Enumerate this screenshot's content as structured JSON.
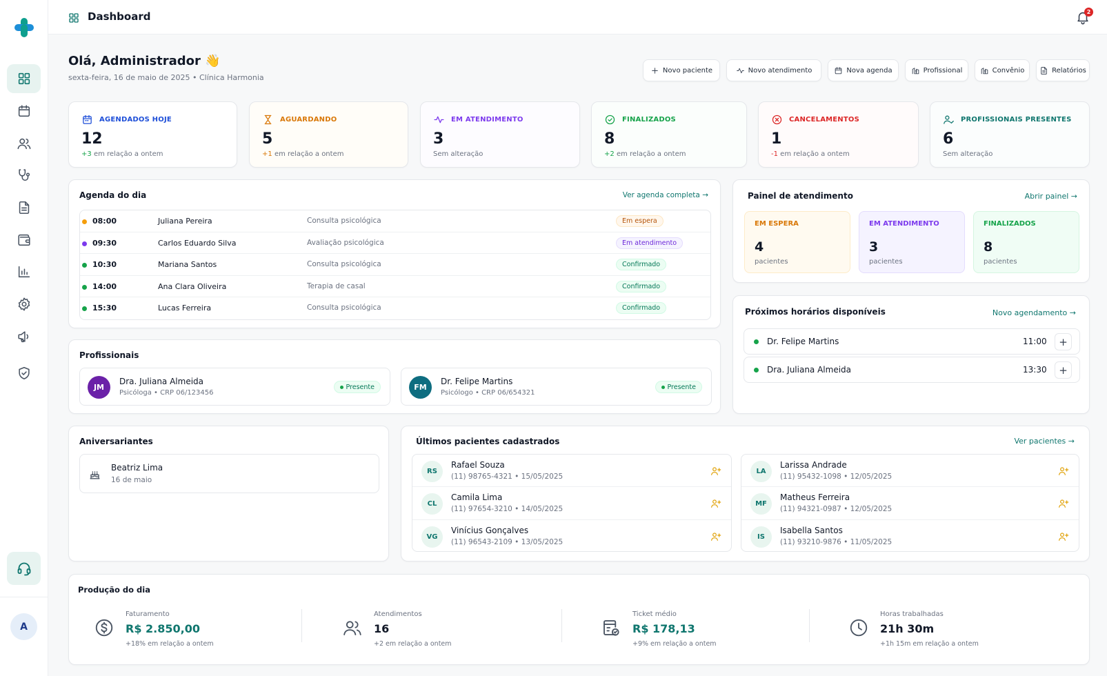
{
  "topbar": {
    "title": "Dashboard",
    "notifications": "2"
  },
  "sidebar": {
    "items": [
      "grid-icon",
      "calendar-icon",
      "users-icon",
      "stethoscope-icon",
      "document-icon",
      "wallet-icon",
      "bar-chart-icon",
      "gear-icon",
      "megaphone-icon",
      "shield-icon"
    ],
    "support": "headset-icon",
    "user_initial": "A"
  },
  "greeting": {
    "title": "Olá, Administrador 👋",
    "subtitle": "sexta-feira, 16 de maio de 2025 • Clínica Harmonia"
  },
  "actions": [
    {
      "label": "Novo paciente",
      "icon": "plus-icon"
    },
    {
      "label": "Novo atendimento",
      "icon": "activity-icon"
    },
    {
      "label": "Nova agenda",
      "icon": "calendar-icon"
    },
    {
      "label": "Profissional",
      "icon": "building-icon"
    },
    {
      "label": "Convênio",
      "icon": "building-icon"
    },
    {
      "label": "Relatórios",
      "icon": "document-icon"
    }
  ],
  "stats": [
    {
      "label": "AGENDADOS HOJE",
      "value": "12",
      "delta": "+3",
      "change": "em relação a ontem",
      "color": "#1d4ed8",
      "bg": "#ffffff"
    },
    {
      "label": "AGUARDANDO",
      "value": "5",
      "delta": "+1",
      "change": "em relação a ontem",
      "color": "#d97706",
      "bg": "#fffdf8"
    },
    {
      "label": "EM ATENDIMENTO",
      "value": "3",
      "delta": "",
      "change": "Sem alteração",
      "color": "#7c3aed",
      "bg": "#fdfcff"
    },
    {
      "label": "FINALIZADOS",
      "value": "8",
      "delta": "+2",
      "change": "em relação a ontem",
      "color": "#16a34a",
      "bg": "#fbfefc"
    },
    {
      "label": "CANCELAMENTOS",
      "value": "1",
      "delta": "-1",
      "change": "em relação a ontem",
      "color": "#dc2626",
      "bg": "#fffbfb"
    },
    {
      "label": "PROFISSIONAIS PRESENTES",
      "value": "6",
      "delta": "",
      "change": "Sem alteração",
      "color": "#0f766e",
      "bg": "#fbfdfd"
    }
  ],
  "agenda": {
    "title": "Agenda do dia",
    "link": "Ver agenda completa →",
    "rows": [
      {
        "time": "08:00",
        "name": "Juliana Pereira",
        "service": "Consulta psicológica",
        "status": "Em espera",
        "dot": "#f59e0b",
        "badge_fg": "#b45309",
        "badge_bg": "#fff7ed",
        "badge_bd": "#fde7c4"
      },
      {
        "time": "09:30",
        "name": "Carlos Eduardo Silva",
        "service": "Avaliação psicológica",
        "status": "Em atendimento",
        "dot": "#7c3aed",
        "badge_fg": "#6d28d9",
        "badge_bg": "#f5f3ff",
        "badge_bd": "#e4dcfd"
      },
      {
        "time": "10:30",
        "name": "Mariana Santos",
        "service": "Consulta psicológica",
        "status": "Confirmado",
        "dot": "#16a34a",
        "badge_fg": "#047857",
        "badge_bg": "#ecfdf3",
        "badge_bd": "#d1fae5"
      },
      {
        "time": "14:00",
        "name": "Ana Clara Oliveira",
        "service": "Terapia de casal",
        "status": "Confirmado",
        "dot": "#16a34a",
        "badge_fg": "#047857",
        "badge_bg": "#ecfdf3",
        "badge_bd": "#d1fae5"
      },
      {
        "time": "15:30",
        "name": "Lucas Ferreira",
        "service": "Consulta psicológica",
        "status": "Confirmado",
        "dot": "#16a34a",
        "badge_fg": "#047857",
        "badge_bg": "#ecfdf3",
        "badge_bd": "#d1fae5"
      }
    ]
  },
  "painel": {
    "title": "Painel de atendimento",
    "link": "Abrir painel →",
    "boxes": [
      {
        "label": "EM ESPERA",
        "value": "4",
        "sub": "pacientes",
        "color": "#d97706",
        "bg": "#fffaf0",
        "bd": "#fdebc8"
      },
      {
        "label": "EM ATENDIMENTO",
        "value": "3",
        "sub": "pacientes",
        "color": "#7c3aed",
        "bg": "#f5f3ff",
        "bd": "#e4dcfd"
      },
      {
        "label": "FINALIZADOS",
        "value": "8",
        "sub": "pacientes",
        "color": "#16a34a",
        "bg": "#f0fdf5",
        "bd": "#d5f5e1"
      }
    ]
  },
  "horarios": {
    "title": "Próximos horários disponíveis",
    "link": "Novo agendamento →",
    "items": [
      {
        "name": "Dr. Felipe Martins",
        "time": "11:00"
      },
      {
        "name": "Dra. Juliana Almeida",
        "time": "13:30"
      }
    ]
  },
  "profissionais": {
    "title": "Profissionais",
    "items": [
      {
        "initials": "JM",
        "name": "Dra. Juliana Almeida",
        "role": "Psicóloga • CRP 06/123456",
        "status": "Presente",
        "color": "#6b21a8"
      },
      {
        "initials": "FM",
        "name": "Dr. Felipe Martins",
        "role": "Psicólogo • CRP 06/654321",
        "status": "Presente",
        "color": "#0e6d80"
      }
    ]
  },
  "aniversariantes": {
    "title": "Aniversariantes",
    "items": [
      {
        "name": "Beatriz Lima",
        "date": "16 de maio"
      }
    ]
  },
  "pacientes": {
    "title": "Últimos pacientes cadastrados",
    "link": "Ver pacientes →",
    "left": [
      {
        "initials": "RS",
        "name": "Rafael Souza",
        "meta": "(11) 98765-4321 • 15/05/2025"
      },
      {
        "initials": "CL",
        "name": "Camila Lima",
        "meta": "(11) 97654-3210 • 14/05/2025"
      },
      {
        "initials": "VG",
        "name": "Vinícius Gonçalves",
        "meta": "(11) 96543-2109 • 13/05/2025"
      }
    ],
    "right": [
      {
        "initials": "LA",
        "name": "Larissa Andrade",
        "meta": "(11) 95432-1098 • 12/05/2025"
      },
      {
        "initials": "MF",
        "name": "Matheus Ferreira",
        "meta": "(11) 94321-0987 • 12/05/2025"
      },
      {
        "initials": "IS",
        "name": "Isabella Santos",
        "meta": "(11) 93210-9876 • 11/05/2025"
      }
    ]
  },
  "producao": {
    "title": "Produção do dia",
    "items": [
      {
        "label": "Faturamento",
        "value": "R$ 2.850,00",
        "change": "+18% em relação a ontem",
        "icon": "dollar-icon",
        "color": "#0f766e"
      },
      {
        "label": "Atendimentos",
        "value": "16",
        "change": "+2 em relação a ontem",
        "icon": "users-icon",
        "color": "#111827"
      },
      {
        "label": "Ticket médio",
        "value": "R$ 178,13",
        "change": "+9% em relação a ontem",
        "icon": "receipt-icon",
        "color": "#0f766e"
      },
      {
        "label": "Horas trabalhadas",
        "value": "21h 30m",
        "change": "+1h 15m em relação a ontem",
        "icon": "clock-icon",
        "color": "#111827"
      }
    ]
  }
}
